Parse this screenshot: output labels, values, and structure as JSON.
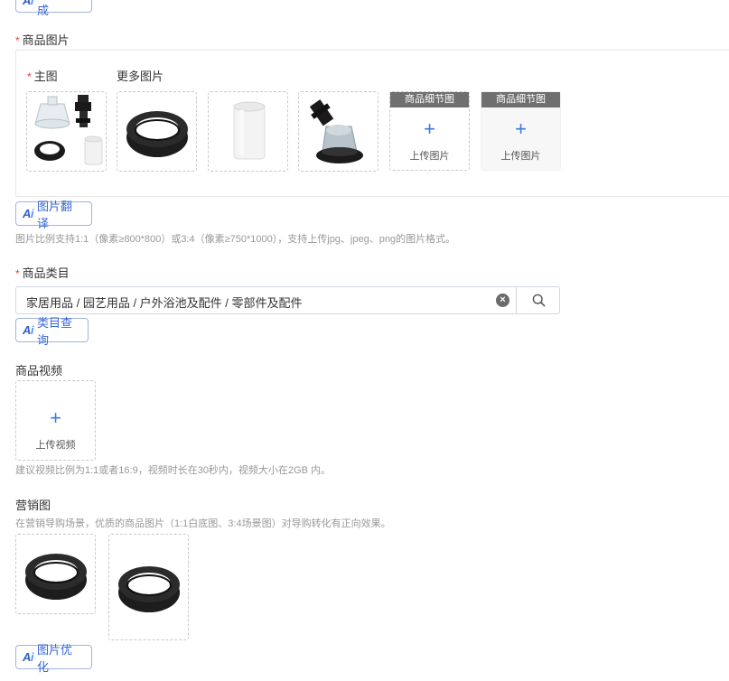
{
  "top": {
    "ai_button_label": "标题生成"
  },
  "images": {
    "section_title": "商品图片",
    "main_label": "主图",
    "more_label": "更多图片",
    "detail_header": "商品细节图",
    "upload_label": "上传图片",
    "translate_label": "图片翻译",
    "hint": "图片比例支持1:1（像素≥800*800）或3:4（像素≥750*1000），支持上传jpg、jpeg、png的图片格式。"
  },
  "category": {
    "section_title": "商品类目",
    "value": "家居用品 / 园艺用品 / 户外浴池及配件 / 零部件及配件",
    "query_label": "类目查询"
  },
  "video": {
    "section_title": "商品视频",
    "upload_label": "上传视频",
    "hint": "建议视频比例为1:1或者16:9，视频时长在30秒内，视频大小在2GB 内。"
  },
  "marketing": {
    "section_title": "营销图",
    "hint": "在营销导购场景，优质的商品图片（1:1白底图、3:4场景图）对导购转化有正向效果。",
    "optimize_label": "图片优化"
  },
  "icons": {
    "required": "required-asterisk",
    "ai_logo": "ai-logo-icon",
    "plus": "plus-icon",
    "clear": "clear-icon",
    "search": "search-icon"
  },
  "colors": {
    "accent": "#3a7be0",
    "required": "#e4393c",
    "detail_header_bg": "#6f6f6f"
  }
}
